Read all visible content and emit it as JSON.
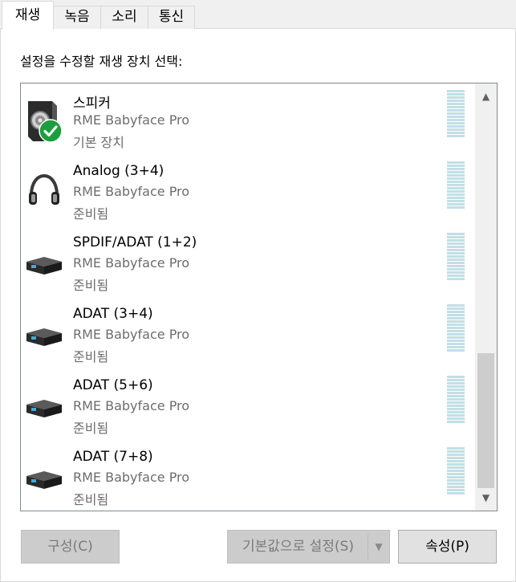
{
  "tabs": [
    {
      "label": "재생",
      "active": true
    },
    {
      "label": "녹음",
      "active": false
    },
    {
      "label": "소리",
      "active": false
    },
    {
      "label": "통신",
      "active": false
    }
  ],
  "instruction": "설정을 수정할 재생 장치 선택:",
  "devices": [
    {
      "name": "스피커",
      "manufacturer": "RME Babyface Pro",
      "status": "기본 장치",
      "icon": "speaker-icon",
      "is_default": true
    },
    {
      "name": "Analog (3+4)",
      "manufacturer": "RME Babyface Pro",
      "status": "준비됨",
      "icon": "headphones-icon",
      "is_default": false
    },
    {
      "name": "SPDIF/ADAT (1+2)",
      "manufacturer": "RME Babyface Pro",
      "status": "준비됨",
      "icon": "digital-output-icon",
      "is_default": false
    },
    {
      "name": "ADAT (3+4)",
      "manufacturer": "RME Babyface Pro",
      "status": "준비됨",
      "icon": "digital-output-icon",
      "is_default": false
    },
    {
      "name": "ADAT (5+6)",
      "manufacturer": "RME Babyface Pro",
      "status": "준비됨",
      "icon": "digital-output-icon",
      "is_default": false
    },
    {
      "name": "ADAT (7+8)",
      "manufacturer": "RME Babyface Pro",
      "status": "준비됨",
      "icon": "digital-output-icon",
      "is_default": false
    }
  ],
  "buttons": {
    "configure": "구성(C)",
    "set_default": "기본값으로 설정(S)",
    "properties": "속성(P)"
  },
  "colors": {
    "meter": "#c2dfe6",
    "check": "#1b9e3e"
  }
}
